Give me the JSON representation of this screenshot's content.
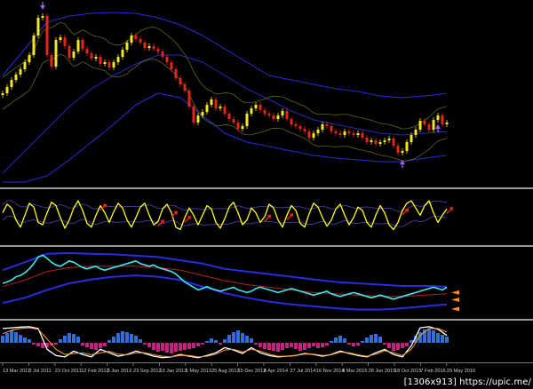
{
  "watermark": {
    "text": "[1306x913] https://upic.me/"
  },
  "x_axis": {
    "tick_labels": [
      "13 Mar 2011",
      "3 Jul 2011",
      "23 Oct 2011",
      "12 Feb 2012",
      "3 Jun 2012",
      "23 Sep 2012",
      "13 Jan 2013",
      "5 May 2013",
      "25 Aug 2013",
      "15 Dec 2013",
      "6 Apr 2014",
      "27 Jul 2014",
      "16 Nov 2014",
      "8 Mar 2015",
      "28 Jun 2015",
      "18 Oct 2015",
      "7 Feb 2016",
      "29 May 2016"
    ]
  },
  "chart_data": [
    {
      "type": "line",
      "ylim": [
        0,
        100
      ],
      "up_color": "#f4e526",
      "down_color": "#e3261c",
      "envelope_color": "#56681f",
      "series": [
        {
          "values": [
            50,
            53.5,
            57.5,
            60.5,
            63.5,
            67.5,
            71.5,
            82.5,
            92.5,
            93.5,
            71.5,
            65,
            80,
            81.5,
            76.5,
            70,
            73.5,
            80,
            75,
            72.5,
            69.5,
            70.5,
            66.5,
            67.5,
            64.5,
            67.5,
            70.5,
            74.5,
            78.5,
            82.5,
            80.5,
            78.5,
            75.5,
            76.5,
            75,
            73.5,
            70.5,
            67.5,
            63.5,
            58.5,
            55,
            51.5,
            42.5,
            33.5,
            37.5,
            39.5,
            43.5,
            46.5,
            41.5,
            42.5,
            38.5,
            35.5,
            33.5,
            30,
            31.5,
            38.5,
            41.5,
            43.5,
            40.5,
            38.5,
            37.5,
            35.5,
            37.5,
            40,
            35.5,
            32.5,
            31.5,
            30,
            28.5,
            25,
            27.5,
            29.5,
            32.5,
            31.5,
            28.5,
            27.5,
            26.5,
            28.5,
            27.5,
            26.5,
            27.5,
            25,
            22.5,
            23.5,
            21.5,
            22.5,
            23.5,
            24.5,
            20.5,
            16.5,
            17.5,
            22.5,
            26.5,
            29.5,
            34.5,
            32.5,
            29.5,
            35,
            37.5,
            32.5,
            33.5
          ]
        }
      ],
      "bands": [
        {
          "values": [
            60,
            75,
            90,
            93.5,
            95,
            95.5,
            95,
            92.5,
            88.5,
            82.5,
            75,
            67.5,
            60,
            57.5,
            55,
            52.5,
            51,
            48.5,
            47.5,
            48.5,
            50
          ],
          "color": "#2b2bd8"
        },
        {
          "values": [
            5,
            17.5,
            30,
            42.5,
            52.5,
            60,
            66.5,
            71.5,
            71.5,
            67.5,
            60,
            52.5,
            46.5,
            40,
            35,
            32.5,
            30,
            27.5,
            26.5,
            27.5,
            28.5
          ],
          "color": "#2727b8"
        },
        {
          "values": [
            0,
            0,
            3.5,
            12.5,
            22.5,
            32.5,
            43.5,
            50,
            47.5,
            37.5,
            27.5,
            22.5,
            20,
            17.5,
            15,
            13.5,
            12.5,
            11.5,
            11.5,
            13.5,
            15
          ],
          "color": "#2b2bd8"
        }
      ],
      "markers": [
        {
          "index": 9,
          "icon": "down-arrow-icon",
          "color": "#9a5cf5"
        },
        {
          "index": 90,
          "icon": "up-arrow-icon",
          "color": "#9a5cf5"
        },
        {
          "index": 98,
          "icon": "up-arrow-icon",
          "color": "#9a5cf5"
        }
      ]
    },
    {
      "type": "line",
      "ylim": [
        0,
        100
      ],
      "band_color": "#5b3fb4",
      "marker_color": "#ff2020",
      "series": [
        {
          "values": [
            60,
            78,
            70,
            45,
            30,
            55,
            80,
            72,
            40,
            35,
            60,
            82,
            75,
            50,
            28,
            45,
            70,
            85,
            65,
            38,
            30,
            55,
            75,
            60,
            40,
            62,
            80,
            70,
            45,
            30,
            50,
            72,
            80,
            55,
            35,
            42,
            68,
            78,
            60,
            30,
            25,
            50,
            70,
            55,
            35,
            55,
            75,
            68,
            40,
            28,
            48,
            72,
            82,
            60,
            35,
            45,
            70,
            60,
            40,
            52,
            78,
            70,
            45,
            30,
            55,
            75,
            65,
            38,
            30,
            58,
            80,
            72,
            50,
            32,
            45,
            68,
            78,
            55,
            35,
            50,
            72,
            65,
            40,
            30,
            55,
            75,
            60,
            35,
            25,
            40,
            65,
            80,
            85,
            70,
            55,
            75,
            85,
            60,
            40,
            55,
            68
          ],
          "color": "#ffff1a"
        }
      ],
      "markers": [
        {
          "index": 22,
          "icon": "up-right-arrow-icon"
        },
        {
          "index": 35,
          "icon": "up-right-arrow-icon"
        },
        {
          "index": 38,
          "icon": "up-right-arrow-icon"
        },
        {
          "index": 41,
          "icon": "up-right-arrow-icon"
        },
        {
          "index": 59,
          "icon": "up-right-arrow-icon"
        },
        {
          "index": 64,
          "icon": "up-right-arrow-icon"
        },
        {
          "index": 90,
          "icon": "up-right-arrow-icon"
        },
        {
          "index": 100,
          "icon": "up-right-arrow-icon"
        }
      ]
    },
    {
      "type": "line",
      "ylim": [
        0,
        100
      ],
      "series": [
        {
          "values": [
            50,
            52,
            55,
            60,
            62,
            66,
            72,
            80,
            90,
            93,
            88,
            82,
            78,
            76,
            80,
            84,
            82,
            78,
            74,
            72,
            74,
            76,
            72,
            70,
            72,
            74,
            76,
            78,
            80,
            82,
            84,
            80,
            78,
            76,
            78,
            74,
            72,
            70,
            68,
            64,
            58,
            52,
            48,
            44,
            40,
            42,
            45,
            42,
            40,
            38,
            40,
            42,
            44,
            40,
            38,
            36,
            38,
            42,
            44,
            42,
            40,
            38,
            36,
            38,
            40,
            42,
            40,
            38,
            36,
            34,
            32,
            34,
            36,
            38,
            34,
            32,
            30,
            32,
            34,
            36,
            34,
            32,
            30,
            28,
            30,
            32,
            30,
            28,
            26,
            28,
            30,
            32,
            34,
            36,
            38,
            40,
            42,
            44,
            42,
            40,
            44
          ],
          "color": "#3fe6ef"
        }
      ],
      "bands": [
        {
          "values": [
            70,
            82,
            95,
            96,
            95,
            94,
            92,
            90,
            85,
            80,
            72,
            68,
            64,
            60,
            56,
            52,
            50,
            48,
            46,
            46,
            45
          ],
          "color": "#2a2ae0"
        },
        {
          "values": [
            20,
            28,
            40,
            50,
            56,
            60,
            62,
            60,
            55,
            45,
            35,
            28,
            22,
            18,
            15,
            12,
            10,
            10,
            12,
            15,
            18
          ],
          "color": "#2a2ae0"
        },
        {
          "values": [
            45,
            55,
            68,
            74,
            76,
            76,
            76,
            74,
            70,
            62,
            54,
            48,
            44,
            40,
            36,
            34,
            32,
            30,
            30,
            32,
            34
          ],
          "color": "#b3241f"
        }
      ],
      "edge_markers": [
        {
          "value": 36
        },
        {
          "value": 25
        },
        {
          "value": 11
        }
      ],
      "edge_marker_color": "#ff8a1e"
    },
    {
      "type": "bar",
      "ylim": [
        -100,
        100
      ],
      "positive_color": "#2f6fd6",
      "negative_color": "#c2237f",
      "values": [
        40,
        55,
        70,
        60,
        45,
        30,
        20,
        -10,
        -20,
        -30,
        -25,
        -15,
        -10,
        20,
        40,
        55,
        50,
        35,
        -15,
        -25,
        -35,
        -40,
        -30,
        -20,
        15,
        35,
        55,
        65,
        60,
        50,
        40,
        20,
        -10,
        -25,
        -40,
        -50,
        -45,
        -55,
        -60,
        -50,
        -45,
        -40,
        -35,
        -30,
        -20,
        -10,
        10,
        25,
        15,
        -10,
        20,
        45,
        60,
        70,
        55,
        40,
        25,
        -10,
        -25,
        -35,
        -40,
        -45,
        -50,
        -40,
        -30,
        -25,
        -35,
        -45,
        -40,
        -30,
        -20,
        -30,
        -25,
        -15,
        10,
        30,
        40,
        25,
        -10,
        -20,
        -15,
        10,
        30,
        45,
        50,
        35,
        -10,
        -30,
        -45,
        -40,
        -30,
        -20,
        15,
        40,
        60,
        75,
        80,
        70,
        55,
        45,
        35
      ],
      "series_ylim": [
        0,
        100
      ],
      "series": [
        {
          "values": [
            90,
            92,
            94,
            95,
            90,
            30,
            12,
            8,
            25,
            15,
            8,
            30,
            20,
            10,
            15,
            25,
            18,
            10,
            6,
            8,
            15,
            10,
            6,
            12,
            20,
            35,
            28,
            18,
            35,
            20,
            12,
            8,
            10,
            12,
            18,
            15,
            10,
            15,
            25,
            18,
            12,
            8,
            20,
            30,
            15,
            8,
            40,
            92,
            95,
            88,
            70
          ],
          "color": "#ffffff"
        },
        {
          "values": [
            75,
            85,
            90,
            92,
            88,
            60,
            30,
            15,
            18,
            20,
            14,
            20,
            24,
            16,
            14,
            20,
            20,
            14,
            10,
            8,
            12,
            12,
            8,
            10,
            16,
            28,
            30,
            22,
            30,
            25,
            16,
            10,
            10,
            12,
            16,
            16,
            12,
            14,
            22,
            20,
            14,
            10,
            16,
            26,
            20,
            12,
            30,
            70,
            90,
            90,
            80
          ],
          "color": "#ff9a2e"
        }
      ]
    }
  ]
}
